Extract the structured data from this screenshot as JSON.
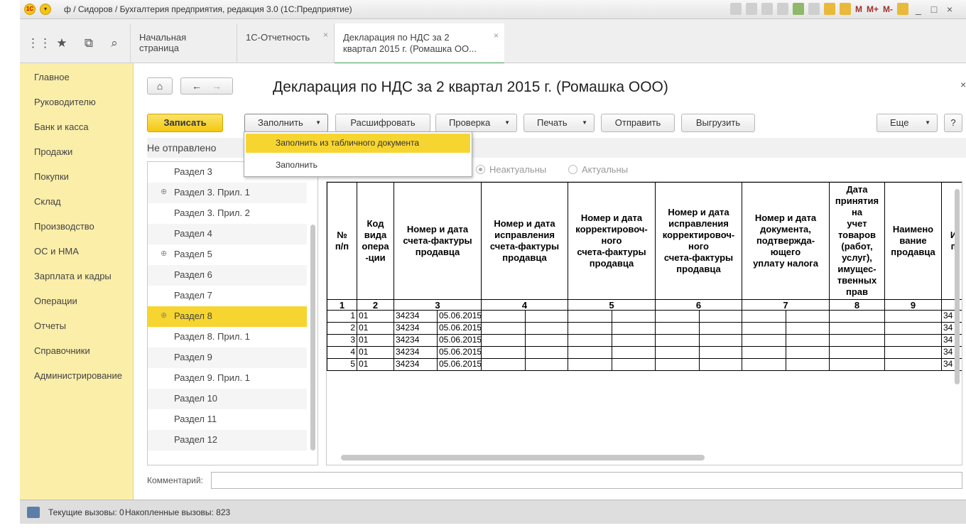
{
  "window": {
    "title": "ф / Сидоров / Бухгалтерия предприятия, редакция 3.0  (1С:Предприятие)",
    "toolbar_text_buttons": [
      "M",
      "M+",
      "M-"
    ],
    "window_controls": [
      "_",
      "□",
      "×"
    ]
  },
  "tabs": [
    {
      "label": "Начальная страница",
      "closable": false
    },
    {
      "label": "1С-Отчетность",
      "closable": true
    },
    {
      "label_line1": "Декларация по НДС за 2",
      "label_line2": "квартал 2015 г. (Ромашка ОО...",
      "closable": true
    }
  ],
  "sidebar": {
    "items": [
      "Главное",
      "Руководителю",
      "Банк и касса",
      "Продажи",
      "Покупки",
      "Склад",
      "Производство",
      "ОС и НМА",
      "Зарплата и кадры",
      "Операции",
      "Отчеты",
      "Справочники",
      "Администрирование"
    ]
  },
  "form": {
    "title": "Декларация по НДС за 2 квартал 2015 г. (Ромашка ООО)",
    "status": "Не отправлено",
    "buttons": {
      "save": "Записать",
      "fill": "Заполнить",
      "decode": "Расшифровать",
      "check": "Проверка",
      "print": "Печать",
      "send": "Отправить",
      "export": "Выгрузить",
      "more": "Еще",
      "help": "?"
    },
    "fill_menu": [
      "Заполнить из табличного документа",
      "Заполнить"
    ],
    "radios": [
      {
        "label": "Неактуальны",
        "selected": true
      },
      {
        "label": "Актуальны",
        "selected": false
      }
    ],
    "comment_label": "Комментарий:",
    "comment_value": ""
  },
  "sections": [
    {
      "label": "Раздел 3",
      "expandable": false
    },
    {
      "label": "Раздел 3. Прил. 1",
      "expandable": true
    },
    {
      "label": "Раздел 3. Прил. 2",
      "expandable": false
    },
    {
      "label": "Раздел 4",
      "expandable": false
    },
    {
      "label": "Раздел 5",
      "expandable": true
    },
    {
      "label": "Раздел 6",
      "expandable": false
    },
    {
      "label": "Раздел 7",
      "expandable": false
    },
    {
      "label": "Раздел 8",
      "expandable": true,
      "selected": true
    },
    {
      "label": "Раздел 8. Прил. 1",
      "expandable": false
    },
    {
      "label": "Раздел 9",
      "expandable": false
    },
    {
      "label": "Раздел 9. Прил. 1",
      "expandable": false
    },
    {
      "label": "Раздел 10",
      "expandable": false
    },
    {
      "label": "Раздел 11",
      "expandable": false
    },
    {
      "label": "Раздел 12",
      "expandable": false
    }
  ],
  "table": {
    "headers": [
      "№\nп/п",
      "Код\nвида\nопера\n-ции",
      "Номер и дата\nсчета-фактуры\nпродавца",
      "Номер и дата\nисправления\nсчета-фактуры\nпродавца",
      "Номер и дата\nкорректировоч-\nного\nсчета-фактуры\nпродавца",
      "Номер и дата\nисправления\nкорректировоч-\nного\nсчета-фактуры\nпродавца",
      "Номер и дата\nдокумента,\nподтвержда-\nющего\nуплату налога",
      "Дата\nпринятия\nна\nучет\nтоваров\n(работ,\nуслуг),\nимущес-\nтвенных\nправ",
      "Наимено\nвание\nпродавца",
      "И\nп"
    ],
    "column_numbers": [
      "1",
      "2",
      "3",
      "4",
      "5",
      "6",
      "7",
      "8",
      "9",
      ""
    ],
    "rows": [
      {
        "n": "1",
        "code": "01",
        "inv_no": "34234",
        "inv_date": "05.06.2015",
        "tail": "34"
      },
      {
        "n": "2",
        "code": "01",
        "inv_no": "34234",
        "inv_date": "05.06.2015",
        "tail": "34"
      },
      {
        "n": "3",
        "code": "01",
        "inv_no": "34234",
        "inv_date": "05.06.2015",
        "tail": "34"
      },
      {
        "n": "4",
        "code": "01",
        "inv_no": "34234",
        "inv_date": "05.06.2015",
        "tail": "34"
      },
      {
        "n": "5",
        "code": "01",
        "inv_no": "34234",
        "inv_date": "05.06.2015",
        "tail": "34"
      }
    ]
  },
  "statusbar": {
    "current_calls": "Текущие вызовы: 0",
    "accumulated_calls": "Накопленные вызовы: 823"
  }
}
